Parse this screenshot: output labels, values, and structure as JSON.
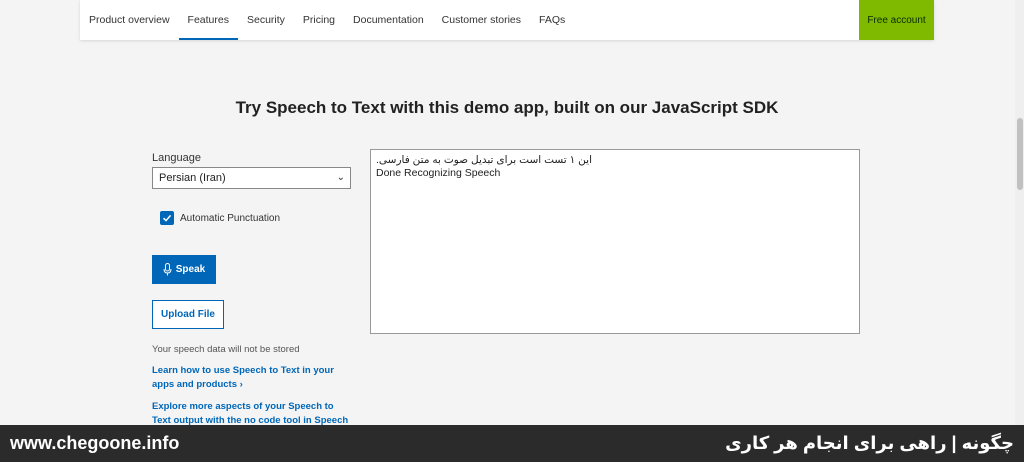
{
  "nav": {
    "items": [
      "Product overview",
      "Features",
      "Security",
      "Pricing",
      "Documentation",
      "Customer stories",
      "FAQs"
    ],
    "active": "Features",
    "free_account": "Free account",
    "accent_color": "#0067b8",
    "cta_color": "#7fba00"
  },
  "main": {
    "title": "Try Speech to Text with this demo app, built on our JavaScript SDK"
  },
  "form": {
    "language_label": "Language",
    "language_value": "Persian (Iran)",
    "punctuation_label": "Automatic Punctuation",
    "punctuation_checked": true,
    "speak_label": "Speak",
    "upload_label": "Upload File",
    "privacy_note": "Your speech data will not be stored",
    "learn_link": "Learn how to use Speech to Text in your apps and products",
    "explore_link": "Explore more aspects of your Speech to Text output with the no code tool in Speech"
  },
  "output": {
    "line1": "این ۱ تست است برای تبدیل صوت به متن فارسی.",
    "line2": "Done Recognizing Speech"
  },
  "watermark": {
    "url": "www.chegoone.info",
    "tagline": "چگونه | راهی برای انجام هر کاری"
  }
}
